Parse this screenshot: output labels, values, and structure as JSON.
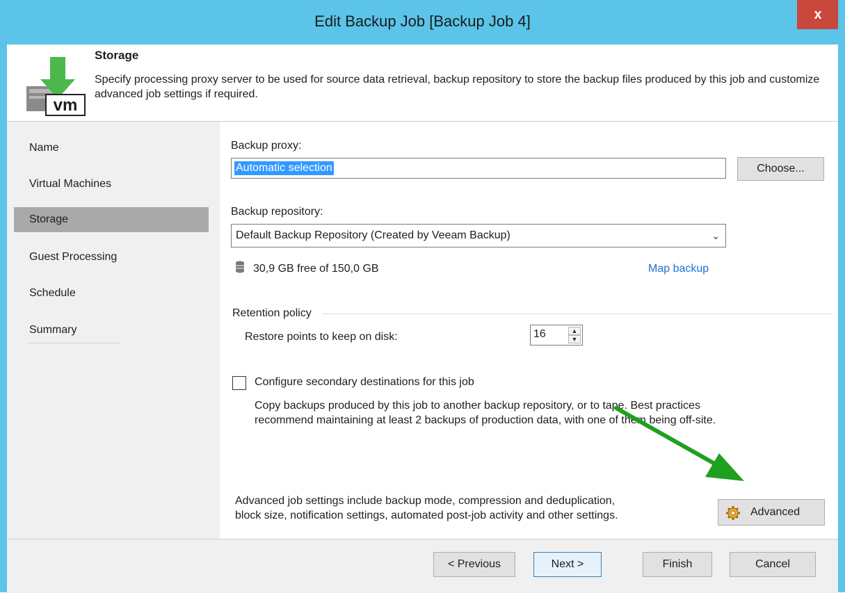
{
  "window": {
    "title": "Edit Backup Job [Backup Job 4]",
    "close_glyph": "x"
  },
  "header": {
    "title": "Storage",
    "description": "Specify processing proxy server to be used for source data retrieval, backup repository to store the backup files produced by this job and customize advanced job settings if required.",
    "icon": "vm-download-icon"
  },
  "nav": {
    "items": [
      {
        "label": "Name"
      },
      {
        "label": "Virtual Machines"
      },
      {
        "label": "Storage",
        "active": true
      },
      {
        "label": "Guest Processing"
      },
      {
        "label": "Schedule"
      },
      {
        "label": "Summary"
      }
    ]
  },
  "main": {
    "proxy_label": "Backup proxy:",
    "proxy_value": "Automatic selection",
    "choose_label": "Choose...",
    "repo_label": "Backup repository:",
    "repo_value": "Default Backup Repository (Created by Veeam Backup)",
    "repo_free": "30,9 GB free of 150,0 GB",
    "map_backup": "Map backup",
    "retention_label": "Retention policy",
    "restore_points_label": "Restore points to keep on disk:",
    "restore_points_value": "16",
    "secondary_label": "Configure secondary destinations for this job",
    "secondary_checked": false,
    "secondary_desc_1": "Copy backups produced by this job to another backup repository, or to tape. Best practices",
    "secondary_desc_2": "recommend maintaining at least 2 backups of production data, with one of them being off-site.",
    "advanced_desc_1": "Advanced job settings include backup mode, compression and deduplication,",
    "advanced_desc_2": "block size, notification settings, automated post-job activity and other settings.",
    "advanced_label": "Advanced"
  },
  "footer": {
    "previous": "< Previous",
    "next": "Next >",
    "finish": "Finish",
    "cancel": "Cancel"
  },
  "colors": {
    "title_bar": "#5bc4e8",
    "close_button": "#c9473b",
    "selection": "#3399ff",
    "link": "#1c6fd0",
    "annotation_arrow": "#1fa01f"
  }
}
